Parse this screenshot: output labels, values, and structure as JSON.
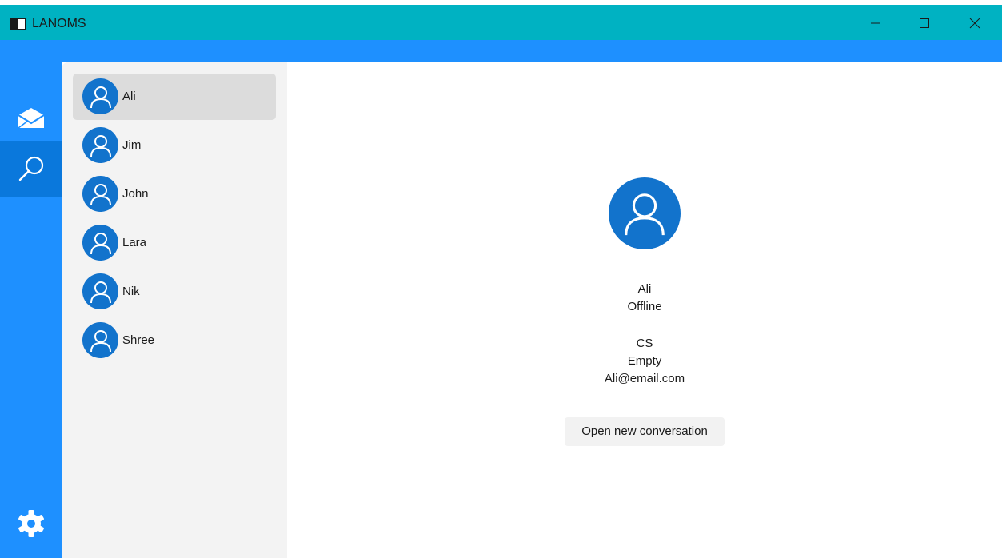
{
  "window": {
    "title": "LANOMS",
    "controls": [
      "minimize-icon",
      "maximize-icon",
      "close-icon"
    ]
  },
  "colors": {
    "titlebar": "#00b2c2",
    "accent": "#1e90ff",
    "nav_selected": "#0a78dc",
    "avatar": "#1273cc",
    "list_bg": "#f3f3f3",
    "list_selected": "#dcdcdc",
    "button_bg": "#f2f2f2"
  },
  "nav": {
    "items": [
      {
        "icon": "envelope-icon",
        "selected": false
      },
      {
        "icon": "search-icon",
        "selected": true
      },
      {
        "icon": "gear-icon",
        "selected": false
      }
    ]
  },
  "contacts": [
    {
      "name": "Ali",
      "selected": true
    },
    {
      "name": "Jim",
      "selected": false
    },
    {
      "name": "John",
      "selected": false
    },
    {
      "name": "Lara",
      "selected": false
    },
    {
      "name": "Nik",
      "selected": false
    },
    {
      "name": "Shree",
      "selected": false
    }
  ],
  "detail": {
    "avatar_icon": "user-icon",
    "name": "Ali",
    "status": "Offline",
    "department": "CS",
    "description": "Empty",
    "email": "Ali@email.com",
    "open_button_label": "Open new conversation"
  }
}
